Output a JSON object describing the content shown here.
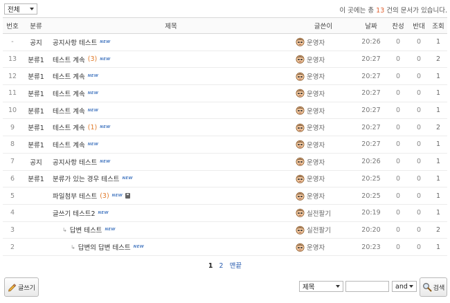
{
  "category_filter": {
    "selected": "전체"
  },
  "doc_count": {
    "prefix": "이 곳에는 총 ",
    "count": "13",
    "suffix": " 건의 문서가 있습니다."
  },
  "columns": {
    "no": "번호",
    "category": "분류",
    "title": "제목",
    "author": "글쓴이",
    "date": "날짜",
    "like": "찬성",
    "dislike": "반대",
    "views": "조회"
  },
  "rows": [
    {
      "no": "-",
      "category": "공지",
      "title": "공지사항 테스트",
      "comments": "",
      "new": "NEW",
      "attach": false,
      "reply_level": 0,
      "author": "운영자",
      "author_icon": "user-avatar-icon",
      "date": "20:26",
      "like": "0",
      "dislike": "0",
      "views": "1"
    },
    {
      "no": "13",
      "category": "분류1",
      "title": "테스트 계속",
      "comments": "(3)",
      "new": "NEW",
      "attach": false,
      "reply_level": 0,
      "author": "운영자",
      "author_icon": "user-avatar-icon",
      "date": "20:27",
      "like": "0",
      "dislike": "0",
      "views": "2"
    },
    {
      "no": "12",
      "category": "분류1",
      "title": "테스트 계속",
      "comments": "",
      "new": "NEW",
      "attach": false,
      "reply_level": 0,
      "author": "운영자",
      "author_icon": "user-avatar-icon",
      "date": "20:27",
      "like": "0",
      "dislike": "0",
      "views": "1"
    },
    {
      "no": "11",
      "category": "분류1",
      "title": "테스트 계속",
      "comments": "",
      "new": "NEW",
      "attach": false,
      "reply_level": 0,
      "author": "운영자",
      "author_icon": "user-avatar-icon",
      "date": "20:27",
      "like": "0",
      "dislike": "0",
      "views": "1"
    },
    {
      "no": "10",
      "category": "분류1",
      "title": "테스트 계속",
      "comments": "",
      "new": "NEW",
      "attach": false,
      "reply_level": 0,
      "author": "운영자",
      "author_icon": "user-avatar-icon",
      "date": "20:27",
      "like": "0",
      "dislike": "0",
      "views": "1"
    },
    {
      "no": "9",
      "category": "분류1",
      "title": "테스트 계속",
      "comments": "(1)",
      "new": "NEW",
      "attach": false,
      "reply_level": 0,
      "author": "운영자",
      "author_icon": "user-avatar-icon",
      "date": "20:27",
      "like": "0",
      "dislike": "0",
      "views": "2"
    },
    {
      "no": "8",
      "category": "분류1",
      "title": "테스트 계속",
      "comments": "",
      "new": "NEW",
      "attach": false,
      "reply_level": 0,
      "author": "운영자",
      "author_icon": "user-avatar-icon",
      "date": "20:27",
      "like": "0",
      "dislike": "0",
      "views": "1"
    },
    {
      "no": "7",
      "category": "공지",
      "title": "공지사항 테스트",
      "comments": "",
      "new": "NEW",
      "attach": false,
      "reply_level": 0,
      "author": "운영자",
      "author_icon": "user-avatar-icon",
      "date": "20:26",
      "like": "0",
      "dislike": "0",
      "views": "1"
    },
    {
      "no": "6",
      "category": "분류1",
      "title": "분류가 있는 경우 테스트",
      "comments": "",
      "new": "NEW",
      "attach": false,
      "reply_level": 0,
      "author": "운영자",
      "author_icon": "user-avatar-icon",
      "date": "20:25",
      "like": "0",
      "dislike": "0",
      "views": "1"
    },
    {
      "no": "5",
      "category": "",
      "title": "파일첨부 테스트",
      "comments": "(3)",
      "new": "NEW",
      "attach": true,
      "reply_level": 0,
      "author": "운영자",
      "author_icon": "user-avatar-icon",
      "date": "20:25",
      "like": "0",
      "dislike": "0",
      "views": "1"
    },
    {
      "no": "4",
      "category": "",
      "title": "글쓰기 테스트2",
      "comments": "",
      "new": "NEW",
      "attach": false,
      "reply_level": 0,
      "author": "실전팔기",
      "author_icon": "user-avatar-icon",
      "date": "20:19",
      "like": "0",
      "dislike": "0",
      "views": "1"
    },
    {
      "no": "3",
      "category": "",
      "title": "답변 테스트",
      "comments": "",
      "new": "NEW",
      "attach": false,
      "reply_level": 1,
      "author": "실전팔기",
      "author_icon": "user-avatar-icon",
      "date": "20:20",
      "like": "0",
      "dislike": "0",
      "views": "2"
    },
    {
      "no": "2",
      "category": "",
      "title": "답변의 답변 테스트",
      "comments": "",
      "new": "NEW",
      "attach": false,
      "reply_level": 2,
      "author": "운영자",
      "author_icon": "user-avatar-icon",
      "date": "20:23",
      "like": "0",
      "dislike": "0",
      "views": "1"
    }
  ],
  "reply_marker": "↳",
  "pagination": {
    "pages": [
      "1",
      "2"
    ],
    "current": "1",
    "last_label": "맨끝"
  },
  "write_button": {
    "label": "글쓰기",
    "icon": "pencil-icon"
  },
  "search": {
    "target_selected": "제목",
    "keyword": "",
    "operator_selected": "and",
    "button_label": "검색",
    "button_icon": "magnifier-icon"
  },
  "colors": {
    "count_highlight": "#e06030",
    "comment_count": "#e07a2a",
    "new_badge": "#4f7fc4",
    "link": "#2a5db0"
  }
}
